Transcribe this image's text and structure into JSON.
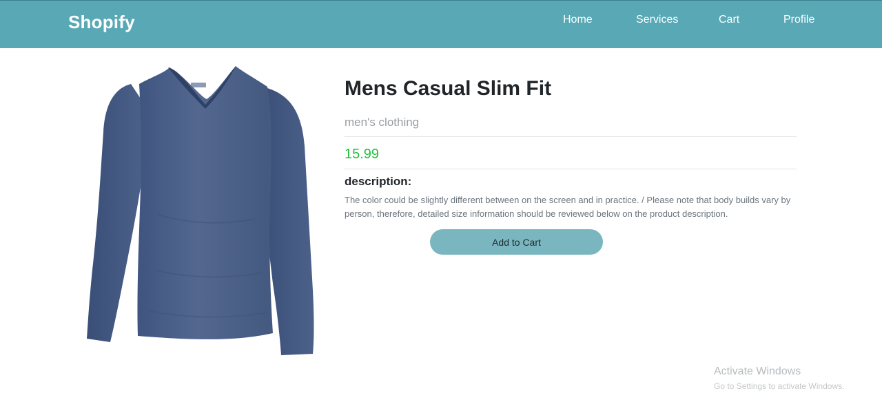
{
  "navbar": {
    "brand": "Shopify",
    "links": [
      {
        "label": "Home"
      },
      {
        "label": "Services"
      },
      {
        "label": "Cart"
      },
      {
        "label": "Profile"
      }
    ],
    "color": "#58a8b6"
  },
  "product": {
    "image_icon": "tshirt-image",
    "title": "Mens Casual Slim Fit",
    "category": "men's clothing",
    "price": "15.99",
    "description_heading": "description:",
    "description": "The color could be slightly different between on the screen and in practice. / Please note that body builds vary by person, therefore, detailed size information should be reviewed below on the product description.",
    "add_to_cart_label": "Add to Cart",
    "price_color": "#1fbf3a",
    "button_color": "#7ab6c0"
  },
  "os_watermark": {
    "title": "Activate Windows",
    "subtitle": "Go to Settings to activate Windows."
  }
}
